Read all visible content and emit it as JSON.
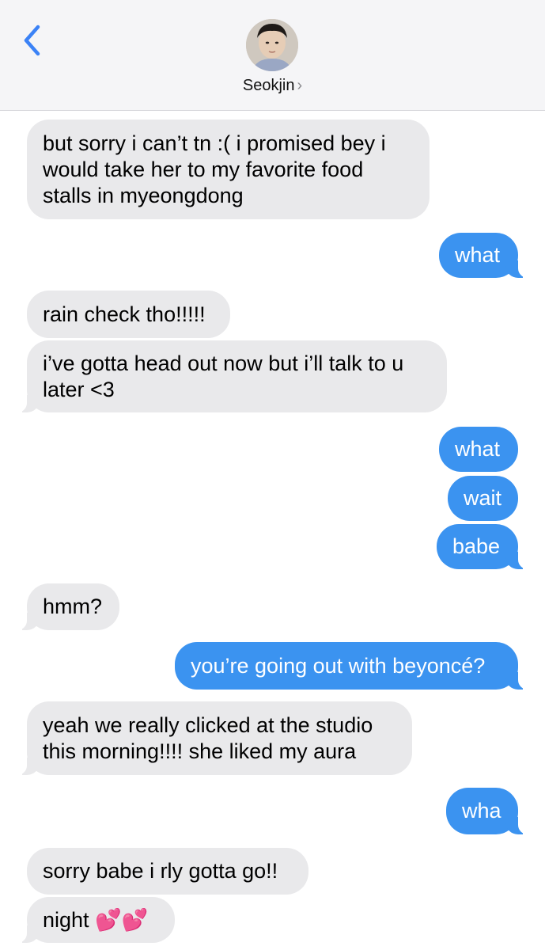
{
  "header": {
    "contact_name": "Seokjin",
    "chevron": "›"
  },
  "colors": {
    "incoming_bubble": "#e9e9eb",
    "outgoing_bubble": "#3b93f0",
    "back_arrow": "#3b82f6"
  },
  "messages": [
    {
      "from": "them",
      "text": "but sorry i can’t tn :( i promised bey i\nwould take her to my favorite food\nstalls in myeongdong"
    },
    {
      "from": "me",
      "text": "what"
    },
    {
      "from": "them",
      "text": "rain check tho!!!!!"
    },
    {
      "from": "them",
      "text": "i’ve gotta head out now but i’ll talk to u\nlater <3"
    },
    {
      "from": "me",
      "text": "what"
    },
    {
      "from": "me",
      "text": "wait"
    },
    {
      "from": "me",
      "text": "babe"
    },
    {
      "from": "them",
      "text": "hmm?"
    },
    {
      "from": "me",
      "text": "you’re going out with beyoncé?"
    },
    {
      "from": "them",
      "text": "yeah we really clicked at the studio\nthis morning!!!! she liked my aura"
    },
    {
      "from": "me",
      "text": "wha"
    },
    {
      "from": "them",
      "text": "sorry babe i rly gotta go!!"
    },
    {
      "from": "them",
      "text": "night 💕💕"
    }
  ]
}
